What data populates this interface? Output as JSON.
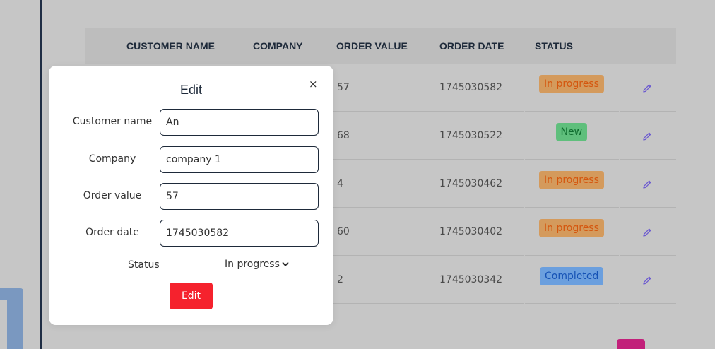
{
  "table": {
    "headers": [
      "CUSTOMER NAME",
      "COMPANY",
      "ORDER VALUE",
      "ORDER DATE",
      "STATUS"
    ],
    "rows": [
      {
        "order_value": "57",
        "order_date": "1745030582",
        "status": "In progress"
      },
      {
        "order_value": "68",
        "order_date": "1745030522",
        "status": "New"
      },
      {
        "order_value": "4",
        "order_date": "1745030462",
        "status": "In progress"
      },
      {
        "order_value": "60",
        "order_date": "1745030402",
        "status": "In progress"
      },
      {
        "order_value": "2",
        "order_date": "1745030342",
        "status": "Completed"
      }
    ]
  },
  "status_colors": {
    "In progress": {
      "bg": "#d49a5c",
      "fg": "#d4560e"
    },
    "New": {
      "bg": "#5fbf7c",
      "fg": "#0f6d2f"
    },
    "Completed": {
      "bg": "#6b9fde",
      "fg": "#1552b5"
    }
  },
  "icons": {
    "row_action": "pencil-icon",
    "close": "close-icon",
    "select_caret": "chevron-down-icon"
  },
  "modal": {
    "title": "Edit",
    "close_label": "×",
    "fields": {
      "customer_name": {
        "label": "Customer name",
        "value": "An"
      },
      "company": {
        "label": "Company",
        "value": "company 1"
      },
      "order_value": {
        "label": "Order value",
        "value": "57"
      },
      "order_date": {
        "label": "Order date",
        "value": "1745030582"
      }
    },
    "status": {
      "label": "Status",
      "selected": "In progress"
    },
    "submit_label": "Edit"
  },
  "colors": {
    "overlay": "#c6c6c6",
    "primary_button": "#f5222d",
    "pager_active": "#c2207a"
  }
}
